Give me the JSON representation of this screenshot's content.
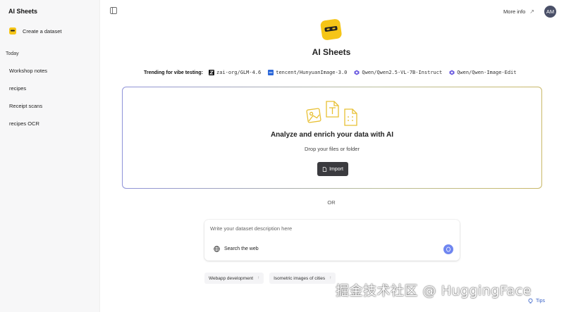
{
  "sidebar": {
    "title": "AI Sheets",
    "create_label": "Create a dataset",
    "section_label": "Today",
    "items": [
      {
        "label": "Workshop notes"
      },
      {
        "label": "recipes"
      },
      {
        "label": "Receipt scans"
      },
      {
        "label": "recipes OCR"
      }
    ]
  },
  "header": {
    "more_info_label": "More info",
    "avatar_initials": "AM"
  },
  "brand": {
    "name": "AI Sheets"
  },
  "trending": {
    "label": "Trending for vibe testing:",
    "models": [
      {
        "name": "zai-org/GLM-4.6",
        "icon": "zai-logo-icon"
      },
      {
        "name": "tencent/HunyuanImage-3.0",
        "icon": "tencent-logo-icon"
      },
      {
        "name": "Qwen/Qwen2.5-VL-7B-Instruct",
        "icon": "qwen-logo-icon"
      },
      {
        "name": "Qwen/Qwen-Image-Edit",
        "icon": "qwen-logo-icon"
      }
    ]
  },
  "dropzone": {
    "title": "Analyze and enrich your data with AI",
    "subtitle": "Drop your files or folder",
    "import_label": "Import"
  },
  "divider_label": "OR",
  "prompt": {
    "placeholder": "Write your dataset description here",
    "search_web_label": "Search the web"
  },
  "suggestions": [
    {
      "label": "Webapp development"
    },
    {
      "label": "Isometric images of cities"
    }
  ],
  "watermark": "掘金技术社区 @ HuggingFace",
  "tips_label": "Tips",
  "colors": {
    "accent": "#f5c518",
    "send_button": "#6f86f0",
    "import_button": "#3b3b3f",
    "avatar": "#4a5068"
  }
}
